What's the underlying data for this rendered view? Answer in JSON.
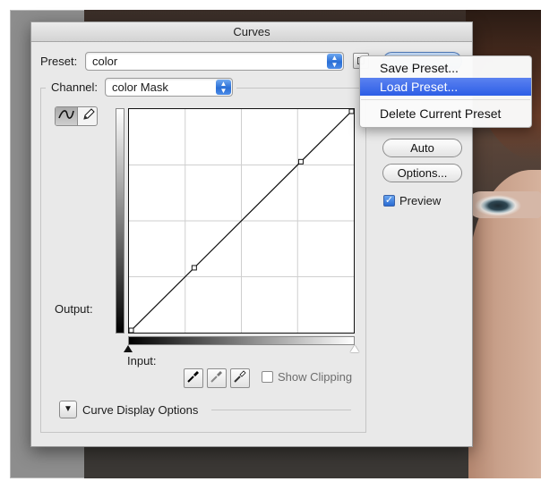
{
  "dialog": {
    "title": "Curves",
    "preset_label": "Preset:",
    "preset_value": "color",
    "channel_label": "Channel:",
    "channel_value": "color Mask",
    "output_label": "Output:",
    "input_label": "Input:",
    "show_clipping_label": "Show Clipping",
    "show_clipping_checked": false,
    "curve_display_options_label": "Curve Display Options"
  },
  "buttons": {
    "auto": "Auto",
    "options": "Options..."
  },
  "preview": {
    "label": "Preview",
    "checked": true
  },
  "preset_menu": {
    "items": [
      {
        "label": "Save Preset...",
        "highlighted": false
      },
      {
        "label": "Load Preset...",
        "highlighted": true
      },
      {
        "label": "Delete Current Preset",
        "highlighted": false
      }
    ]
  },
  "curve": {
    "control_points": [
      [
        0,
        0
      ],
      [
        74,
        74
      ],
      [
        195,
        195
      ],
      [
        255,
        255
      ]
    ],
    "range": [
      0,
      255
    ]
  },
  "colors": {
    "accent": "#2d5ee6",
    "dialog_bg": "#e9e9e9"
  },
  "icons": {
    "curve_tool": "curve-tool-icon",
    "pencil_tool": "pencil-icon",
    "black_eyedropper": "eyedropper-black-icon",
    "gray_eyedropper": "eyedropper-gray-icon",
    "white_eyedropper": "eyedropper-white-icon",
    "preset_options": "preset-options-icon"
  }
}
